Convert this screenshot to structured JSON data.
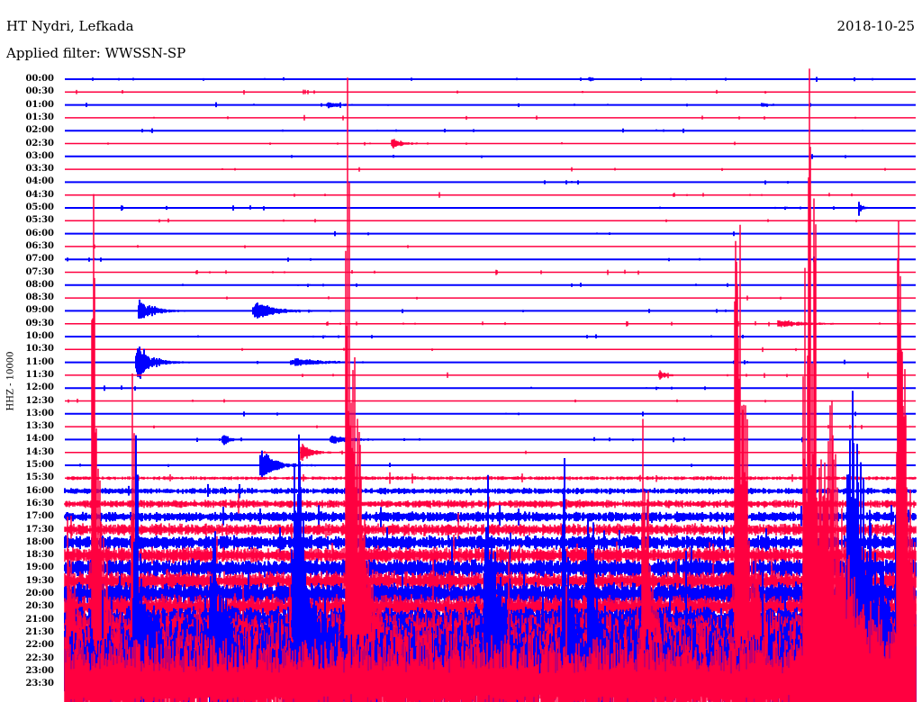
{
  "header": {
    "station": "HT Nydri, Lefkada",
    "filter": "Applied filter: WWSSN-SP",
    "date": "2018-10-25"
  },
  "chart_data": {
    "type": "line",
    "title": "HT Nydri, Lefkada",
    "subtitle": "Applied filter: WWSSN-SP",
    "ylabel": "HHZ - 10000",
    "xlabel": "",
    "x_range_minutes": [
      0,
      30
    ],
    "colors": {
      "hour": "#0000ff",
      "half_hour": "#ff0040"
    },
    "rows": [
      "00:00",
      "00:30",
      "01:00",
      "01:30",
      "02:00",
      "02:30",
      "03:00",
      "03:30",
      "04:00",
      "04:30",
      "05:00",
      "05:30",
      "06:00",
      "06:30",
      "07:00",
      "07:30",
      "08:00",
      "08:30",
      "09:00",
      "09:30",
      "10:00",
      "10:30",
      "11:00",
      "11:30",
      "12:00",
      "12:30",
      "13:00",
      "13:30",
      "14:00",
      "14:30",
      "15:00",
      "15:30",
      "16:00",
      "16:30",
      "17:00",
      "17:30",
      "18:00",
      "18:30",
      "19:00",
      "19:30",
      "20:00",
      "20:30",
      "21:00",
      "21:30",
      "22:00",
      "22:30",
      "23:00",
      "23:30"
    ],
    "events": [
      {
        "row": 0,
        "minute": 18.5,
        "amplitude": 3,
        "width": 0.1
      },
      {
        "row": 2,
        "minute": 9.3,
        "amplitude": 4,
        "width": 0.3
      },
      {
        "row": 2,
        "minute": 24.6,
        "amplitude": 3,
        "width": 0.2
      },
      {
        "row": 5,
        "minute": 11.6,
        "amplitude": 6,
        "width": 0.3
      },
      {
        "row": 10,
        "minute": 28.0,
        "amplitude": 10,
        "width": 0.1
      },
      {
        "row": 18,
        "minute": 2.7,
        "amplitude": 15,
        "width": 0.4
      },
      {
        "row": 18,
        "minute": 6.8,
        "amplitude": 8,
        "width": 0.6
      },
      {
        "row": 18,
        "minute": 6.8,
        "amplitude": 7,
        "width": 0.4
      },
      {
        "row": 19,
        "minute": 25.3,
        "amplitude": 5,
        "width": 0.6
      },
      {
        "row": 22,
        "minute": 2.6,
        "amplitude": 25,
        "width": 0.4
      },
      {
        "row": 22,
        "minute": 8.2,
        "amplitude": 5,
        "width": 0.8
      },
      {
        "row": 23,
        "minute": 21.0,
        "amplitude": 6,
        "width": 0.2
      },
      {
        "row": 28,
        "minute": 5.6,
        "amplitude": 8,
        "width": 0.2
      },
      {
        "row": 28,
        "minute": 9.5,
        "amplitude": 5,
        "width": 0.5
      },
      {
        "row": 29,
        "minute": 8.4,
        "amplitude": 12,
        "width": 0.3
      },
      {
        "row": 30,
        "minute": 7.0,
        "amplitude": 22,
        "width": 0.4
      },
      {
        "row": 47,
        "minute": 26.3,
        "amplitude": 700,
        "width": 0.9
      },
      {
        "row": 47,
        "minute": 29.4,
        "amplitude": 750,
        "width": 0.25
      },
      {
        "row": 46,
        "minute": 2.5,
        "amplitude": 280,
        "width": 0.3
      },
      {
        "row": 46,
        "minute": 8.2,
        "amplitude": 330,
        "width": 0.4
      },
      {
        "row": 46,
        "minute": 14.9,
        "amplitude": 250,
        "width": 0.4
      },
      {
        "row": 46,
        "minute": 17.6,
        "amplitude": 290,
        "width": 0.2
      },
      {
        "row": 46,
        "minute": 18.5,
        "amplitude": 240,
        "width": 0.2
      },
      {
        "row": 46,
        "minute": 5.2,
        "amplitude": 180,
        "width": 0.3
      },
      {
        "row": 46,
        "minute": 27.8,
        "amplitude": 330,
        "width": 0.8
      },
      {
        "row": 45,
        "minute": 10.0,
        "amplitude": 900,
        "width": 0.35
      },
      {
        "row": 45,
        "minute": 23.7,
        "amplitude": 800,
        "width": 0.35
      },
      {
        "row": 45,
        "minute": 1.0,
        "amplitude": 650,
        "width": 0.25
      },
      {
        "row": 45,
        "minute": 20.4,
        "amplitude": 420,
        "width": 0.2
      },
      {
        "row": 45,
        "minute": 29.4,
        "amplitude": 720,
        "width": 0.3
      },
      {
        "row": 45,
        "minute": 0.1,
        "amplitude": 240,
        "width": 0.2
      },
      {
        "row": 45,
        "minute": 2.4,
        "amplitude": 330,
        "width": 0.2
      }
    ]
  }
}
